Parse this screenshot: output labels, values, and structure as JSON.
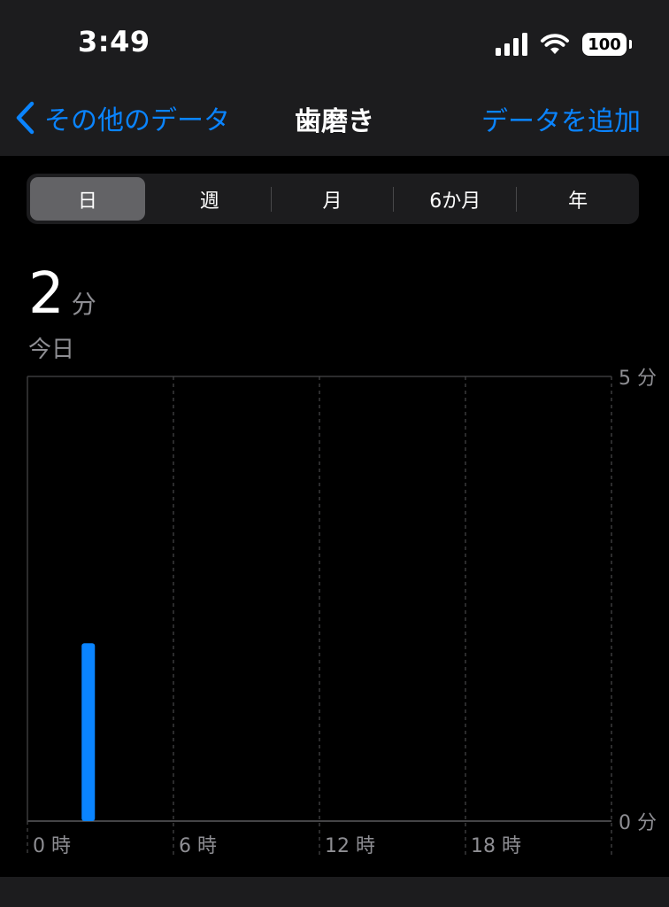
{
  "status_bar": {
    "time": "3:49",
    "battery": "100",
    "icons": [
      "cellular-signal-icon",
      "wifi-icon",
      "battery-icon"
    ]
  },
  "nav": {
    "back_label": "その他のデータ",
    "title": "歯磨き",
    "add_label": "データを追加"
  },
  "segments": [
    {
      "label": "日",
      "selected": true
    },
    {
      "label": "週",
      "selected": false
    },
    {
      "label": "月",
      "selected": false
    },
    {
      "label": "6か月",
      "selected": false
    },
    {
      "label": "年",
      "selected": false
    }
  ],
  "summary": {
    "value": "2",
    "unit": "分",
    "date_label": "今日"
  },
  "colors": {
    "accent": "#0a84ff",
    "background": "#000000",
    "bar": "#0a84ff"
  },
  "chart_data": {
    "type": "bar",
    "x_ticks": [
      "0 時",
      "6 時",
      "12 時",
      "18 時"
    ],
    "y_ticks": [
      "5 分",
      "0 分"
    ],
    "ylim": [
      0,
      5
    ],
    "xlim": [
      0,
      24
    ],
    "bars": [
      {
        "hour": 2.5,
        "value": 2
      }
    ],
    "grid": true
  }
}
